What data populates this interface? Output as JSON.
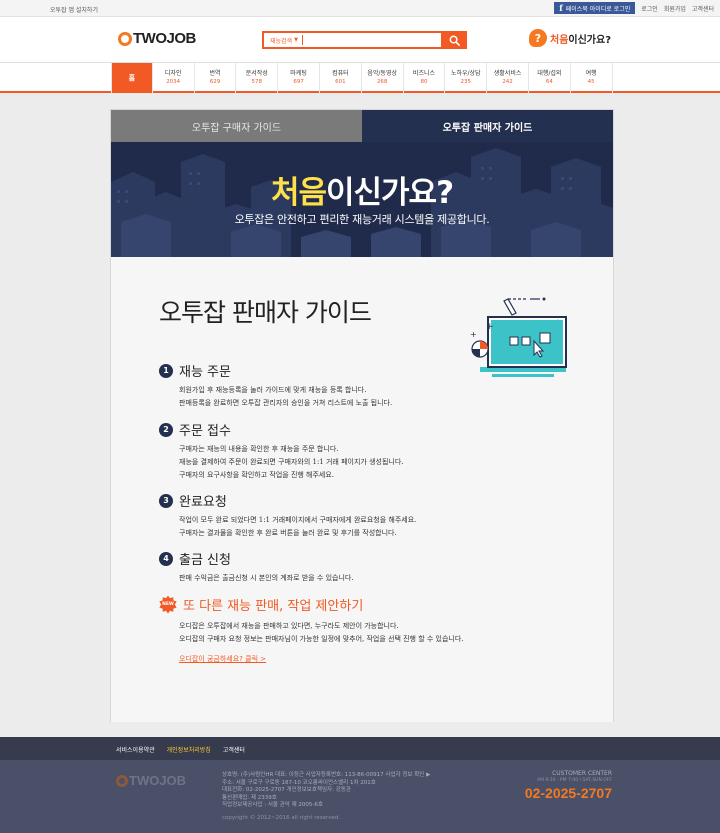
{
  "topbar": {
    "install": "오투잡 앱 설치하기",
    "facebook_login": "페이스북 아이디로 로그인",
    "links": [
      "로그인",
      "회원가입",
      "고객센터"
    ]
  },
  "header": {
    "logo": "TWOJOB",
    "search": {
      "category": "재능검색",
      "value": ""
    },
    "first_visit": {
      "hl": "처음",
      "rest": "이신가요?"
    }
  },
  "categories": [
    {
      "label": "홈",
      "count": ""
    },
    {
      "label": "디자인",
      "count": "2034"
    },
    {
      "label": "번역",
      "count": "629"
    },
    {
      "label": "문서작성",
      "count": "578"
    },
    {
      "label": "마케팅",
      "count": "697"
    },
    {
      "label": "컴퓨터",
      "count": "601"
    },
    {
      "label": "음악/동영상",
      "count": "268"
    },
    {
      "label": "비즈니스",
      "count": "80"
    },
    {
      "label": "노하우/상담",
      "count": "235"
    },
    {
      "label": "생활서비스",
      "count": "242"
    },
    {
      "label": "대행/섭외",
      "count": "64"
    },
    {
      "label": "여행",
      "count": "45"
    }
  ],
  "tabs": {
    "buyer": "오투잡 구매자 가이드",
    "seller": "오투잡 판매자 가이드"
  },
  "banner": {
    "title_hl": "처음",
    "title_rest": "이신가요?",
    "subtitle": "오투잡은 안전하고 편리한 재능거래 시스템을 제공합니다."
  },
  "guide": {
    "title": "오투잡 판매자 가이드",
    "steps": [
      {
        "num": "1",
        "title": "재능 주문",
        "lines": [
          "회원가입 후 재능등록을 눌러 가이드에 맞게 재능을 등록 합니다.",
          "판매등록을 완료하면 오투잡 관리자의 승인을 거쳐 리스트에 노출 됩니다."
        ]
      },
      {
        "num": "2",
        "title": "주문 접수",
        "lines": [
          "구매자는 재능의 내용을 확인한 후 재능을 주문 합니다.",
          "재능을 결제하여 주문이 완료되면 구매자와의 1:1 거래 페이지가 생성됩니다.",
          "구매자의 요구사항을 확인하고 작업을 진행 해주세요."
        ]
      },
      {
        "num": "3",
        "title": "완료요청",
        "lines": [
          "작업이 모두 완료 되었다면 1:1 거래페이지에서 구매자에게 완료요청을 해주세요.",
          "구매자는 결과물을 확인한 후 완료 버튼을 눌러 완료 및 후기를 작성합니다."
        ]
      },
      {
        "num": "4",
        "title": "출금 신청",
        "lines": [
          "판매 수익금은 출금신청 시 본인의 계좌로 받을 수 있습니다."
        ]
      }
    ],
    "extra": {
      "badge": "NEW",
      "title": "또 다른 재능 판매, 작업 제안하기",
      "lines": [
        "오디잡은 오투잡에서 재능을 판매하고 있다면, 누구라도 제안이 가능합니다.",
        "오디잡의 구매자 요청 정보는 판매자님이 가능한 일정에 맞추어, 작업을 선택 진행 할 수 있습니다."
      ],
      "link": "오디잡이 궁금하세요? 클릭 >"
    }
  },
  "footer": {
    "nav": [
      {
        "label": "서비스이용약관",
        "hl": false
      },
      {
        "label": "개인정보처리방침",
        "hl": true
      },
      {
        "label": "고객센터",
        "hl": false
      }
    ],
    "logo": "TWOJOB",
    "info": [
      "상호명: (주)사람인HR   대표: 이정근   사업자등록번호: 113-86-00917 사업자 정보 확인 ▶",
      "주소: 서울 구로구 구로동 187-10 코오롱싸이언스밸리 1차 201호",
      "대표전화: 02-2025-2707  개인정보보호책임자: 강동관",
      "통신판매업: 제 2339호",
      "직업정보제공사업 : 서울 관악 제 2005-6호"
    ],
    "copyright": "copyright © 2012~2016 all right reserved.",
    "cc_label": "CUSTOMER CENTER",
    "cc_hours": "AM 9:30 - PM 7:00 / SAT,SUN OFF",
    "cc_phone": "02-2025-2707"
  }
}
